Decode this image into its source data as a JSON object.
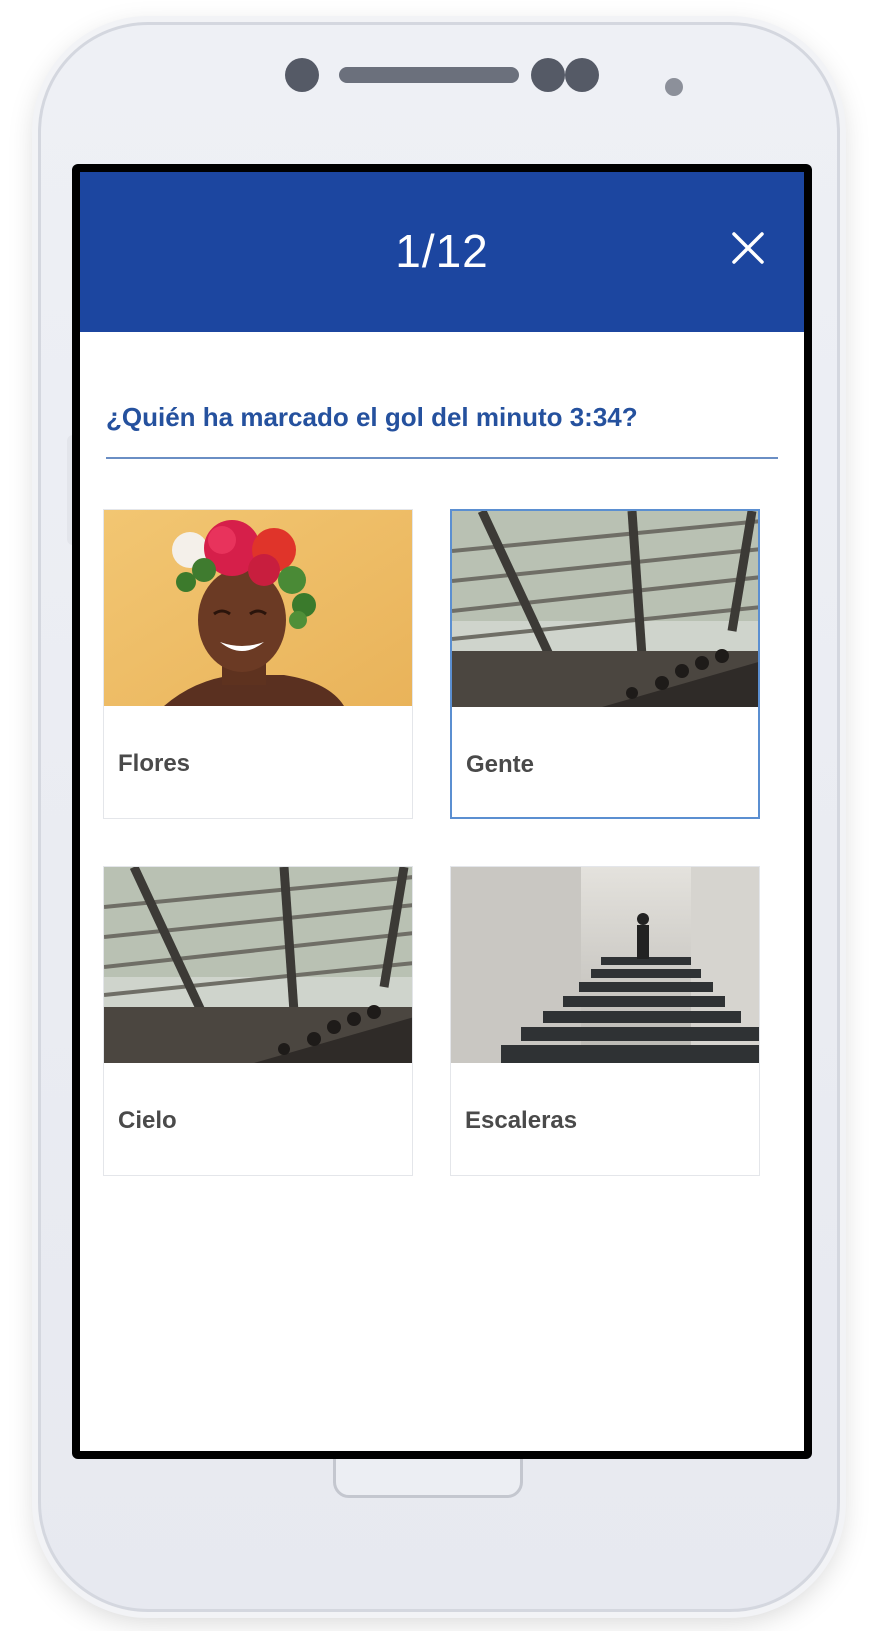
{
  "quiz": {
    "counter": "1/12",
    "question": "¿Quién ha marcado el gol del minuto 3:34?",
    "selected_option": "Gente",
    "options": [
      {
        "label": "Flores",
        "image": "woman-flower-crown"
      },
      {
        "label": "Gente",
        "image": "escalator-glass-roof"
      },
      {
        "label": "Cielo",
        "image": "escalator-glass-roof"
      },
      {
        "label": "Escaleras",
        "image": "man-on-stairs"
      }
    ]
  },
  "icons": {
    "close": "close-icon"
  },
  "colors": {
    "header_bg": "#1c46a0",
    "question_text": "#25519e",
    "selected_border": "#5b8fd1"
  }
}
